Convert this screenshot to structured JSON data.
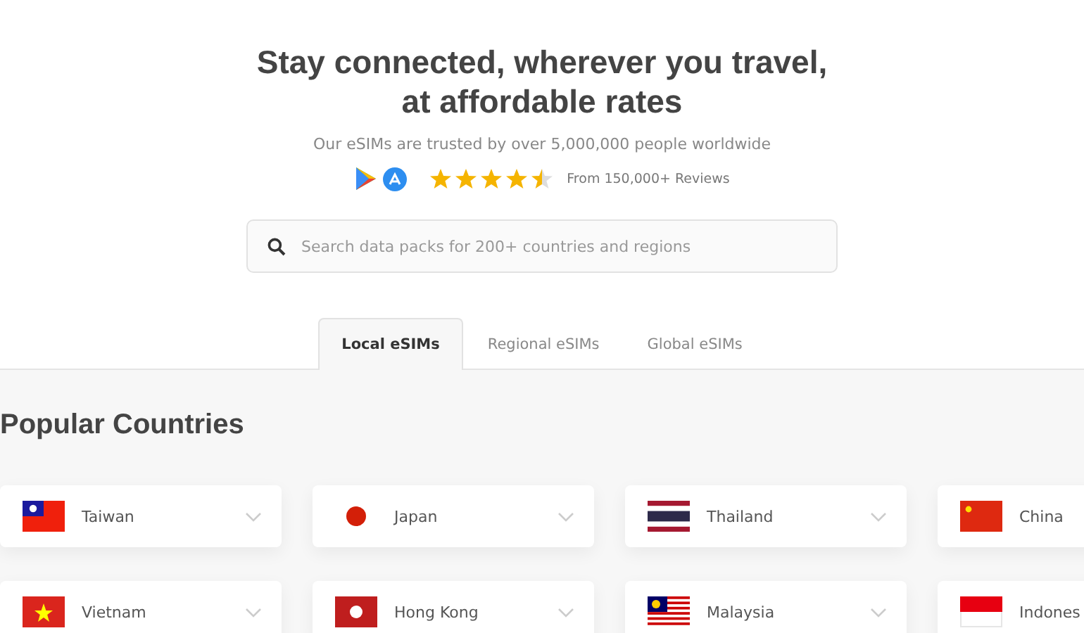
{
  "hero": {
    "title_lines": [
      "Stay connected, wherever you travel,",
      "at affordable rates"
    ],
    "subtitle": "Our eSIMs are trusted by over 5,000,000 people worldwide",
    "rating": {
      "stars": 4.5,
      "reviews": "From 150,000+ Reviews"
    }
  },
  "search": {
    "placeholder": "Search data packs for 200+ countries and regions"
  },
  "tabs": [
    {
      "label": "Local eSIMs",
      "selected": true
    },
    {
      "label": "Regional eSIMs",
      "selected": false
    },
    {
      "label": "Global eSIMs",
      "selected": false
    }
  ],
  "section": {
    "title": "Popular Countries"
  },
  "countries": [
    {
      "name": "Taiwan",
      "kind": "tw"
    },
    {
      "name": "Japan",
      "kind": "jp"
    },
    {
      "name": "Thailand",
      "kind": "th"
    },
    {
      "name": "China",
      "kind": "cn"
    },
    {
      "name": "Vietnam",
      "kind": "vn"
    },
    {
      "name": "Hong Kong",
      "kind": "hk"
    },
    {
      "name": "Malaysia",
      "kind": "my"
    },
    {
      "name": "Indones",
      "kind": "id"
    }
  ]
}
